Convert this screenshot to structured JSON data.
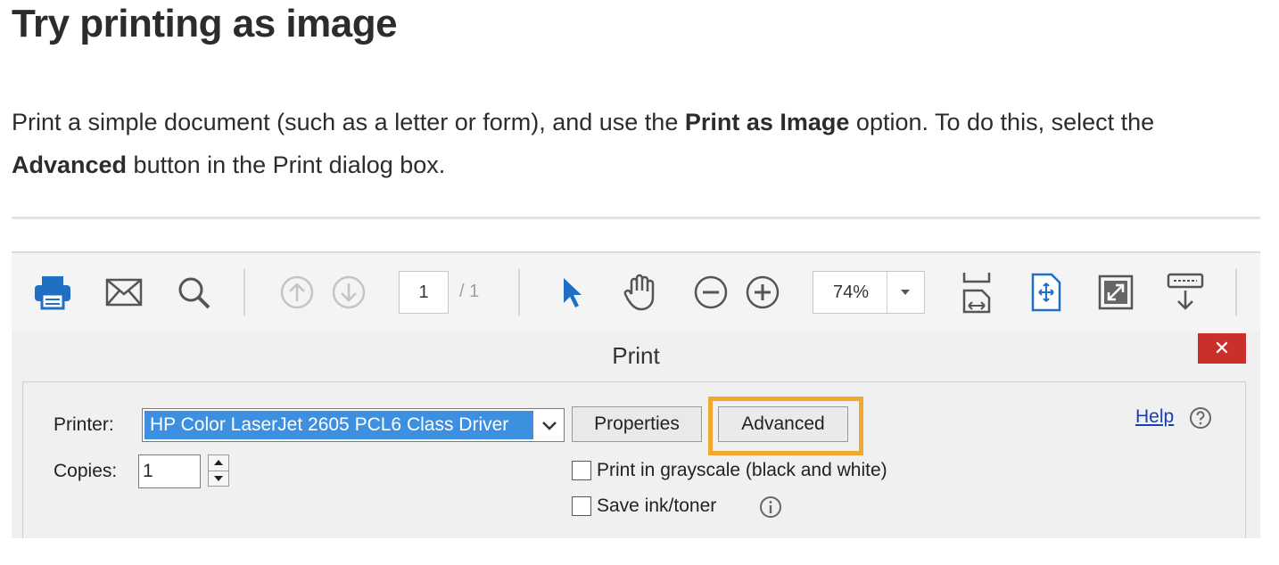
{
  "article": {
    "heading": "Try printing as image",
    "para_line1_a": "Print a simple document (such as a letter or form), and use the ",
    "para_line1_bold": "Print as Image",
    "para_line1_b": " option. To do this, select the",
    "para_line2_bold": "Advanced",
    "para_line2_rest": " button in the Print dialog box."
  },
  "toolbar": {
    "icons": [
      "printer-icon",
      "mail-icon",
      "search-icon",
      "page-up-icon",
      "page-down-icon",
      "select-arrow-icon",
      "hand-icon",
      "zoom-out-icon",
      "zoom-in-icon",
      "fit-width-icon",
      "fit-page-icon",
      "fullscreen-icon",
      "read-mode-icon"
    ],
    "current_page": "1",
    "total_pages": "/ 1",
    "zoom": "74%"
  },
  "dialog": {
    "title": "Print",
    "close_glyph": "✕",
    "printer_label": "Printer:",
    "printer_value": "HP Color LaserJet 2605 PCL6 Class Driver",
    "properties_label": "Properties",
    "advanced_label": "Advanced",
    "help_label": "Help",
    "copies_label": "Copies:",
    "copies_value": "1",
    "grayscale_label": "Print in grayscale (black and white)",
    "grayscale_checked": false,
    "save_ink_label": "Save ink/toner",
    "save_ink_checked": false
  },
  "colors": {
    "highlight": "#f0a830",
    "accent_blue": "#1f6fc5",
    "close_red": "#c9302c",
    "selection_blue": "#3d8fe0"
  }
}
